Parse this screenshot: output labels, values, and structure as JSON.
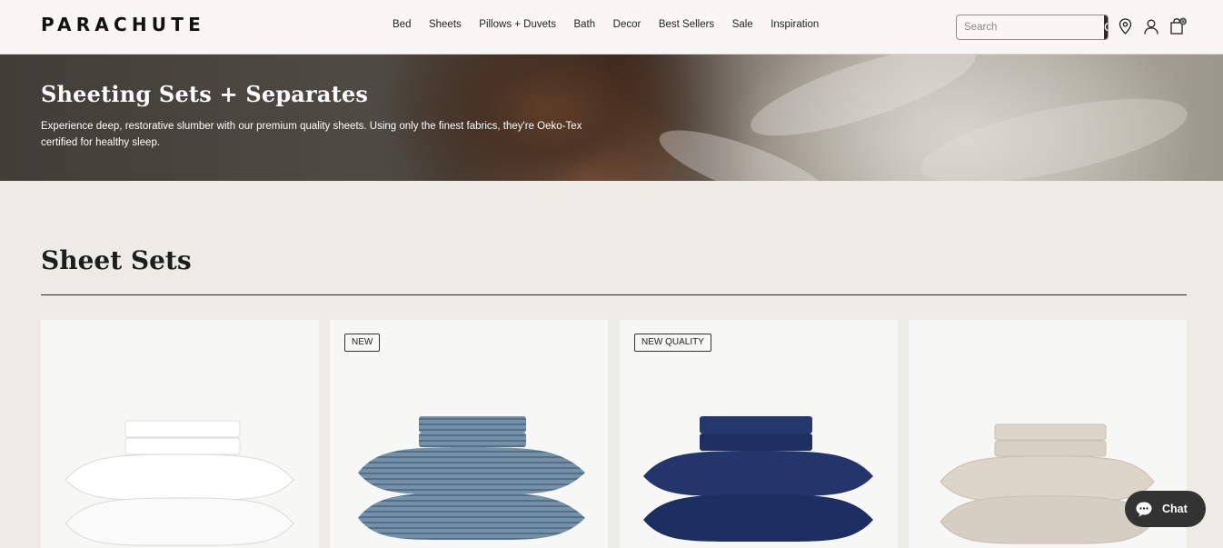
{
  "brand": {
    "logo": "PARACHUTE"
  },
  "nav": [
    {
      "label": "Bed"
    },
    {
      "label": "Sheets"
    },
    {
      "label": "Pillows + Duvets"
    },
    {
      "label": "Bath"
    },
    {
      "label": "Decor"
    },
    {
      "label": "Best Sellers"
    },
    {
      "label": "Sale"
    },
    {
      "label": "Inspiration"
    }
  ],
  "search": {
    "placeholder": "Search",
    "icon": "search-icon"
  },
  "header_icons": [
    "location-icon",
    "account-icon",
    "bag-icon"
  ],
  "cart": {
    "count": "0"
  },
  "hero": {
    "title": "Sheeting Sets + Separates",
    "description": "Experience deep, restorative slumber with our premium quality sheets. Using only the finest fabrics, they're Oeko-Tex certified for healthy sleep."
  },
  "section": {
    "title": "Sheet Sets"
  },
  "products": [
    {
      "badge": "",
      "color": "#ffffff",
      "shade": "#e4e4e2"
    },
    {
      "badge": "NEW",
      "color": "#6e8aa2",
      "shade": "#4d6a84"
    },
    {
      "badge": "NEW QUALITY",
      "color": "#22366b",
      "shade": "#17264f"
    },
    {
      "badge": "",
      "color": "#d9d1c6",
      "shade": "#bfb5a8"
    }
  ],
  "chat": {
    "label": "Chat",
    "icon": "chat-bubble-icon"
  }
}
